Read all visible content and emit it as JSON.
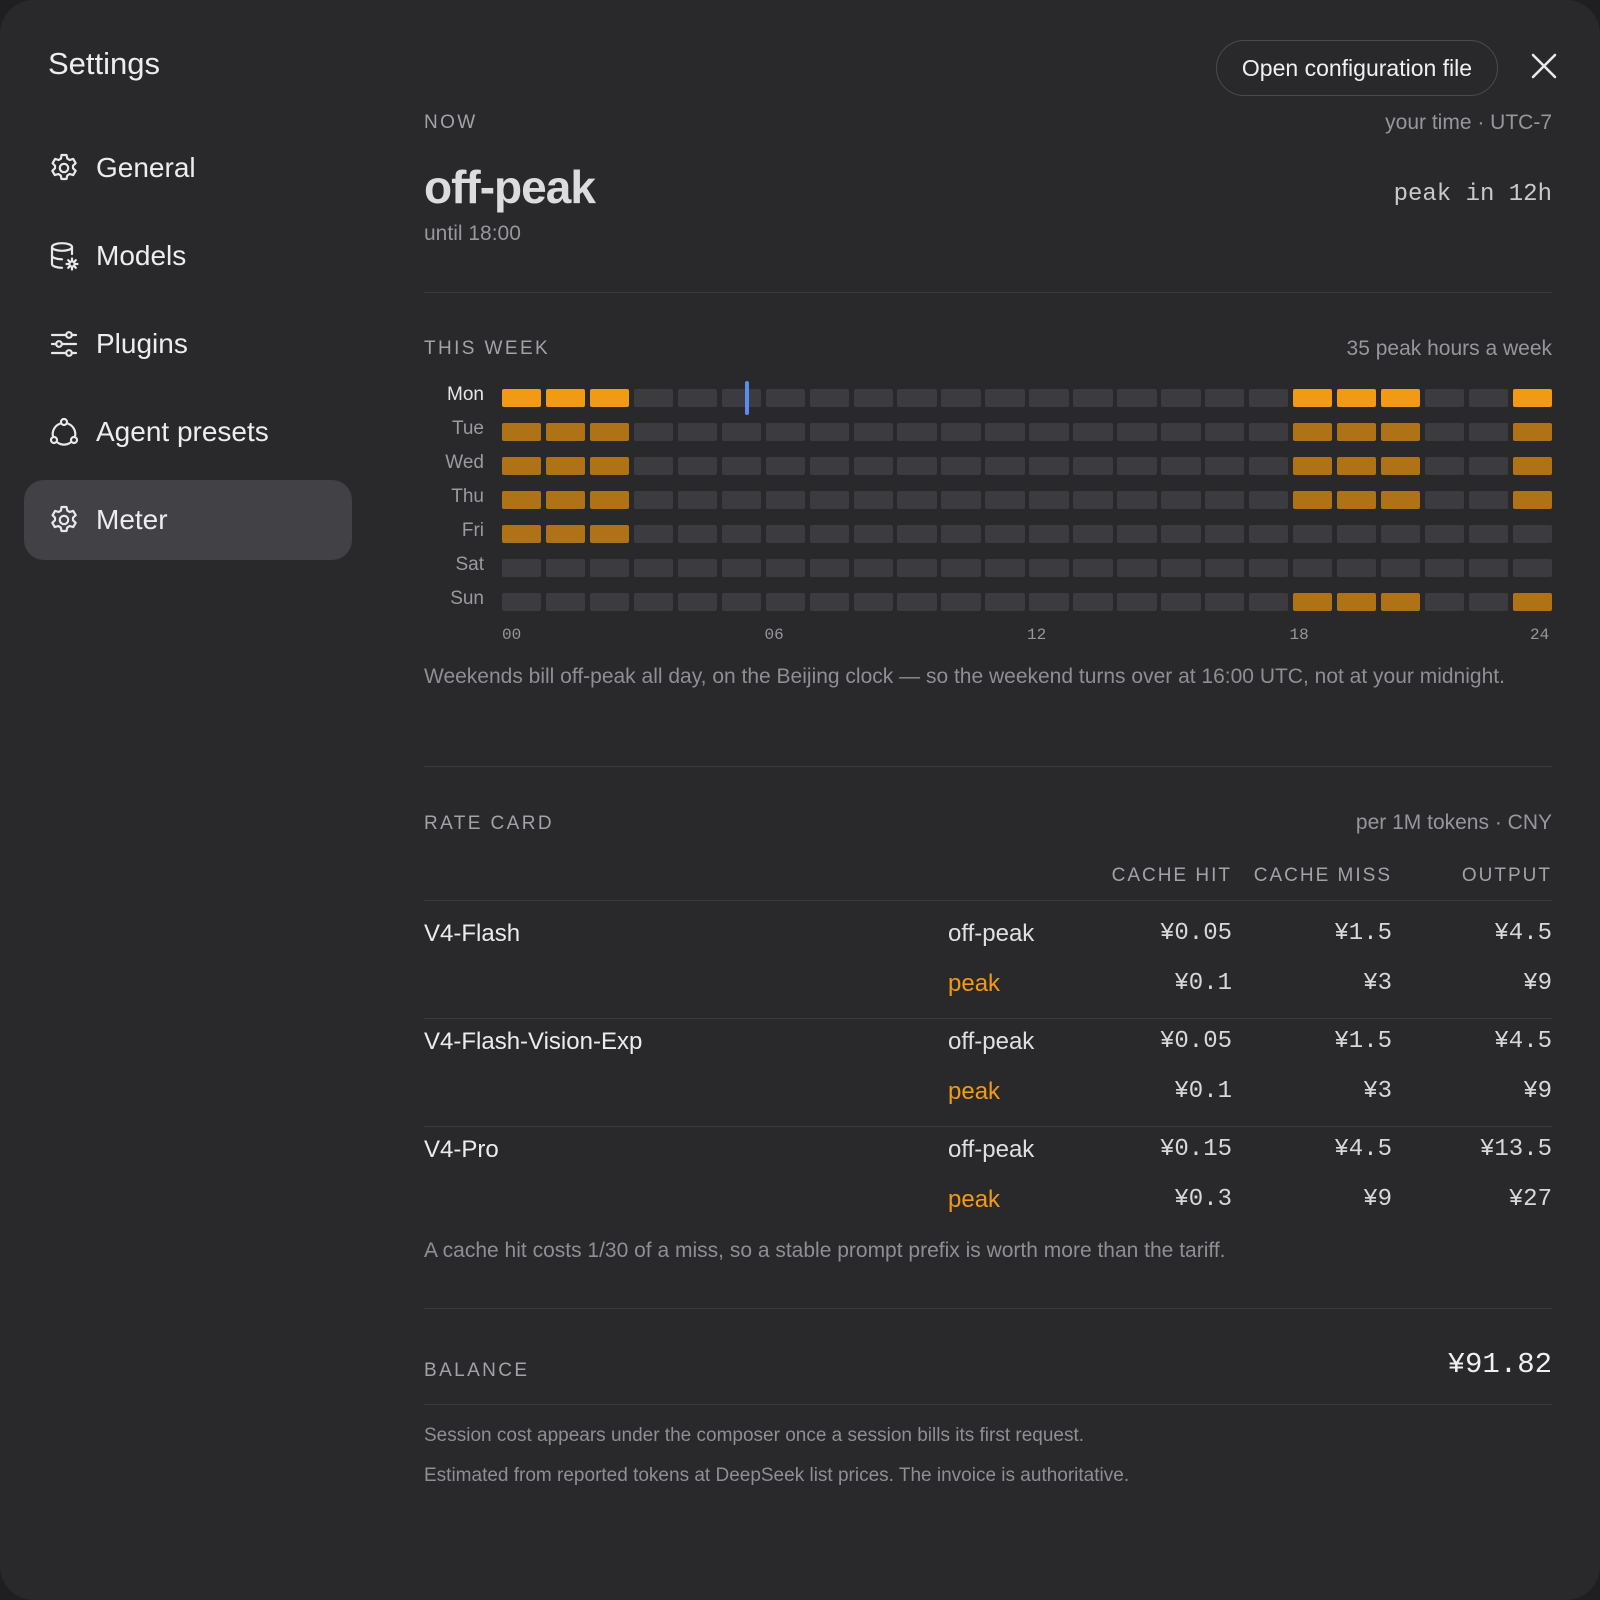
{
  "sidebar": {
    "title": "Settings",
    "items": [
      {
        "label": "General",
        "icon": "gear-icon",
        "active": false
      },
      {
        "label": "Models",
        "icon": "database-gear-icon",
        "active": false
      },
      {
        "label": "Plugins",
        "icon": "sliders-icon",
        "active": false
      },
      {
        "label": "Agent presets",
        "icon": "agents-icon",
        "active": false
      },
      {
        "label": "Meter",
        "icon": "gear-icon",
        "active": true
      }
    ]
  },
  "header": {
    "open_config_label": "Open configuration file",
    "close_icon": "close-icon"
  },
  "now": {
    "label": "NOW",
    "timezone": "your time · UTC-7",
    "state": "off-peak",
    "until": "until 18:00",
    "countdown": "peak in 12h"
  },
  "week": {
    "label": "THIS WEEK",
    "summary": "35 peak hours a week",
    "days": [
      "Mon",
      "Tue",
      "Wed",
      "Thu",
      "Fri",
      "Sat",
      "Sun"
    ],
    "today_index": 0,
    "current_hour": 5.6,
    "peak_hours": [
      [
        0,
        1,
        2,
        18,
        19,
        20,
        23
      ],
      [
        0,
        1,
        2,
        18,
        19,
        20,
        23
      ],
      [
        0,
        1,
        2,
        18,
        19,
        20,
        23
      ],
      [
        0,
        1,
        2,
        18,
        19,
        20,
        23
      ],
      [
        0,
        1,
        2
      ],
      [],
      [
        18,
        19,
        20,
        23
      ]
    ],
    "hour_ticks": [
      "00",
      "06",
      "12",
      "18",
      "24"
    ],
    "note": "Weekends bill off-peak all day, on the Beijing clock — so the weekend turns over at 16:00 UTC, not at your midnight."
  },
  "colors": {
    "peak_today": "#f29a13",
    "peak": "#b07216",
    "offpeak": "#3c3c40",
    "now_marker": "#5b8def",
    "peak_text": "#f29a13"
  },
  "rate_card": {
    "label": "RATE CARD",
    "unit": "per 1M tokens · CNY",
    "columns": [
      "CACHE HIT",
      "CACHE MISS",
      "OUTPUT"
    ],
    "models": [
      {
        "name": "V4-Flash",
        "rows": [
          {
            "tier": "off-peak",
            "hit": "¥0.05",
            "miss": "¥1.5",
            "output": "¥4.5"
          },
          {
            "tier": "peak",
            "hit": "¥0.1",
            "miss": "¥3",
            "output": "¥9"
          }
        ]
      },
      {
        "name": "V4-Flash-Vision-Exp",
        "rows": [
          {
            "tier": "off-peak",
            "hit": "¥0.05",
            "miss": "¥1.5",
            "output": "¥4.5"
          },
          {
            "tier": "peak",
            "hit": "¥0.1",
            "miss": "¥3",
            "output": "¥9"
          }
        ]
      },
      {
        "name": "V4-Pro",
        "rows": [
          {
            "tier": "off-peak",
            "hit": "¥0.15",
            "miss": "¥4.5",
            "output": "¥13.5"
          },
          {
            "tier": "peak",
            "hit": "¥0.3",
            "miss": "¥9",
            "output": "¥27"
          }
        ]
      }
    ],
    "note": "A cache hit costs 1/30 of a miss, so a stable prompt prefix is worth more than the tariff."
  },
  "balance": {
    "label": "BALANCE",
    "value": "¥91.82",
    "note1": "Session cost appears under the composer once a session bills its first request.",
    "note2": "Estimated from reported tokens at DeepSeek list prices. The invoice is authoritative."
  }
}
